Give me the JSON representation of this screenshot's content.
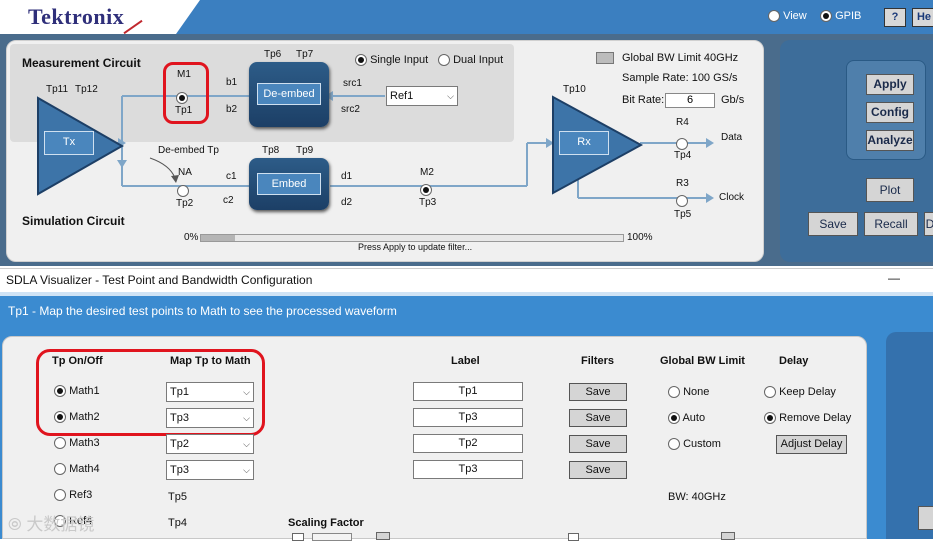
{
  "header": {
    "logo": "Tektronix",
    "view_label": "View",
    "gpib_label": "GPIB",
    "help_label": "?",
    "help2_label": "He"
  },
  "measurement_circuit": {
    "title": "Measurement Circuit",
    "simulation_title": "Simulation Circuit",
    "tx_label": "Tx",
    "rx_label": "Rx",
    "deembed_label": "De-embed",
    "embed_label": "Embed",
    "tp11": "Tp11",
    "tp12": "Tp12",
    "tp6": "Tp6",
    "tp7": "Tp7",
    "tp8": "Tp8",
    "tp9": "Tp9",
    "tp10": "Tp10",
    "m1": "M1",
    "tp1": "Tp1",
    "b1": "b1",
    "b2": "b2",
    "c1": "c1",
    "c2": "c2",
    "d1": "d1",
    "d2": "d2",
    "src1": "src1",
    "src2": "src2",
    "single_input": "Single Input",
    "dual_input": "Dual Input",
    "ref_value": "Ref1",
    "deembed_tp": "De-embed Tp",
    "na": "NA",
    "tp2": "Tp2",
    "m2": "M2",
    "tp3": "Tp3",
    "r4": "R4",
    "tp4": "Tp4",
    "data": "Data",
    "r3": "R3",
    "tp5": "Tp5",
    "clock": "Clock",
    "global_bw": "Global BW Limit 40GHz",
    "sample_rate": "Sample Rate: 100 GS/s",
    "bit_rate_label": "Bit Rate:",
    "bit_rate_value": "6",
    "bit_rate_unit": "Gb/s",
    "progress_start": "0%",
    "progress_end": "100%",
    "progress_fraction": 0.08,
    "status": "Press Apply to update filter..."
  },
  "side_buttons": {
    "apply": "Apply",
    "config": "Config",
    "analyze": "Analyze",
    "plot": "Plot",
    "save": "Save",
    "recall": "Recall",
    "d": "D"
  },
  "window": {
    "title": "SDLA Visualizer - Test Point and Bandwidth Configuration",
    "minimize": "—",
    "banner": "Tp1 - Map the desired test points to Math to see the processed waveform"
  },
  "table": {
    "headers": {
      "tp_onoff": "Tp On/Off",
      "map": "Map Tp to Math",
      "label": "Label",
      "filters": "Filters",
      "global_bw": "Global BW Limit",
      "delay": "Delay"
    },
    "rows": [
      {
        "name": "Math1",
        "map": "Tp1",
        "label": "Tp1",
        "save": "Save"
      },
      {
        "name": "Math2",
        "map": "Tp3",
        "label": "Tp3",
        "save": "Save"
      },
      {
        "name": "Math3",
        "map": "Tp2",
        "label": "Tp2",
        "save": "Save"
      },
      {
        "name": "Math4",
        "map": "Tp3",
        "label": "Tp3",
        "save": "Save"
      }
    ],
    "ref_rows": [
      {
        "name": "Ref3",
        "tp": "Tp5"
      },
      {
        "name": "Ref4",
        "tp": "Tp4"
      }
    ],
    "bw_none": "None",
    "bw_auto": "Auto",
    "bw_custom": "Custom",
    "keep_delay": "Keep Delay",
    "remove_delay": "Remove Delay",
    "adjust_delay": "Adjust Delay",
    "bw_value": "BW: 40GHz",
    "scaling_factor": "Scaling Factor"
  },
  "watermark": "大数据镜"
}
